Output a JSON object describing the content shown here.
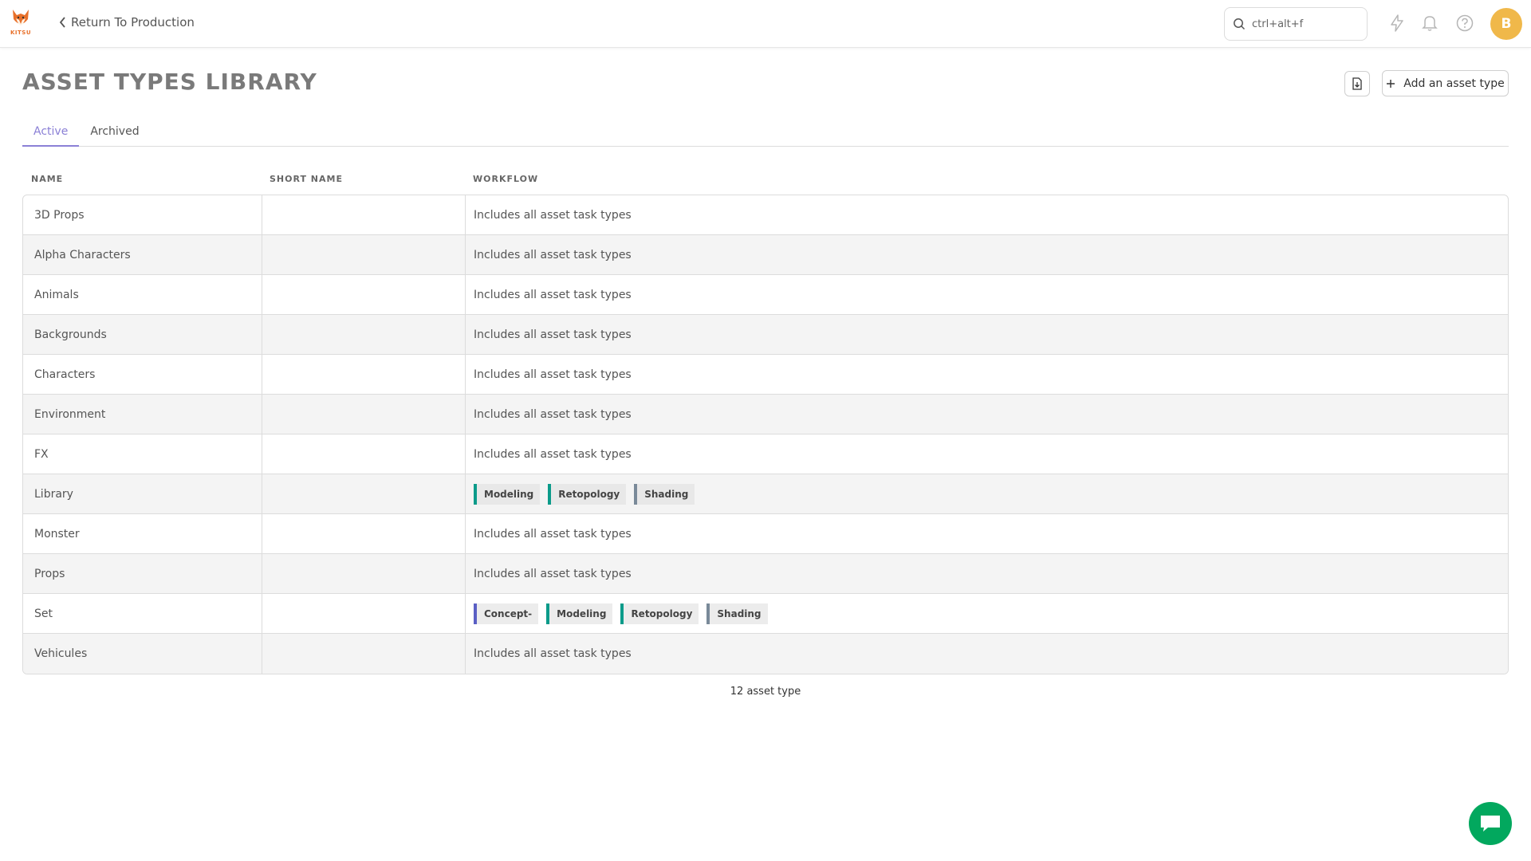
{
  "header": {
    "logo_text": "KITSU",
    "back_label": "Return To Production",
    "search_placeholder": "ctrl+alt+f",
    "avatar_initial": "B"
  },
  "page": {
    "title": "ASSET TYPES LIBRARY",
    "add_button_label": "Add an asset type"
  },
  "tabs": [
    {
      "label": "Active",
      "active": true
    },
    {
      "label": "Archived",
      "active": false
    }
  ],
  "table": {
    "columns": [
      "NAME",
      "SHORT NAME",
      "WORKFLOW"
    ],
    "rows": [
      {
        "name": "3D Props",
        "short_name": "",
        "workflow": "Includes all asset task types",
        "tasks": []
      },
      {
        "name": "Alpha Characters",
        "short_name": "",
        "workflow": "Includes all asset task types",
        "tasks": []
      },
      {
        "name": "Animals",
        "short_name": "",
        "workflow": "Includes all asset task types",
        "tasks": []
      },
      {
        "name": "Backgrounds",
        "short_name": "",
        "workflow": "Includes all asset task types",
        "tasks": []
      },
      {
        "name": "Characters",
        "short_name": "",
        "workflow": "Includes all asset task types",
        "tasks": []
      },
      {
        "name": "Environment",
        "short_name": "",
        "workflow": "Includes all asset task types",
        "tasks": []
      },
      {
        "name": "FX",
        "short_name": "",
        "workflow": "Includes all asset task types",
        "tasks": []
      },
      {
        "name": "Library",
        "short_name": "",
        "workflow": "",
        "tasks": [
          {
            "label": "Modeling",
            "color": "#0b9b8a"
          },
          {
            "label": "Retopology",
            "color": "#0b9b8a"
          },
          {
            "label": "Shading",
            "color": "#7a8a99"
          }
        ]
      },
      {
        "name": "Monster",
        "short_name": "",
        "workflow": "Includes all asset task types",
        "tasks": []
      },
      {
        "name": "Props",
        "short_name": "",
        "workflow": "Includes all asset task types",
        "tasks": []
      },
      {
        "name": "Set",
        "short_name": "",
        "workflow": "",
        "tasks": [
          {
            "label": "Concept-",
            "color": "#5a5fc4"
          },
          {
            "label": "Modeling",
            "color": "#0b9b8a"
          },
          {
            "label": "Retopology",
            "color": "#0b9b8a"
          },
          {
            "label": "Shading",
            "color": "#7a8a99"
          }
        ]
      },
      {
        "name": "Vehicules",
        "short_name": "",
        "workflow": "Includes all asset task types",
        "tasks": []
      }
    ]
  },
  "footer": {
    "count_label": "12 asset type"
  },
  "colors": {
    "accent": "#8b80d6",
    "avatar": "#f0b84a",
    "chat": "#02a85e",
    "logo": "#e8702a"
  }
}
